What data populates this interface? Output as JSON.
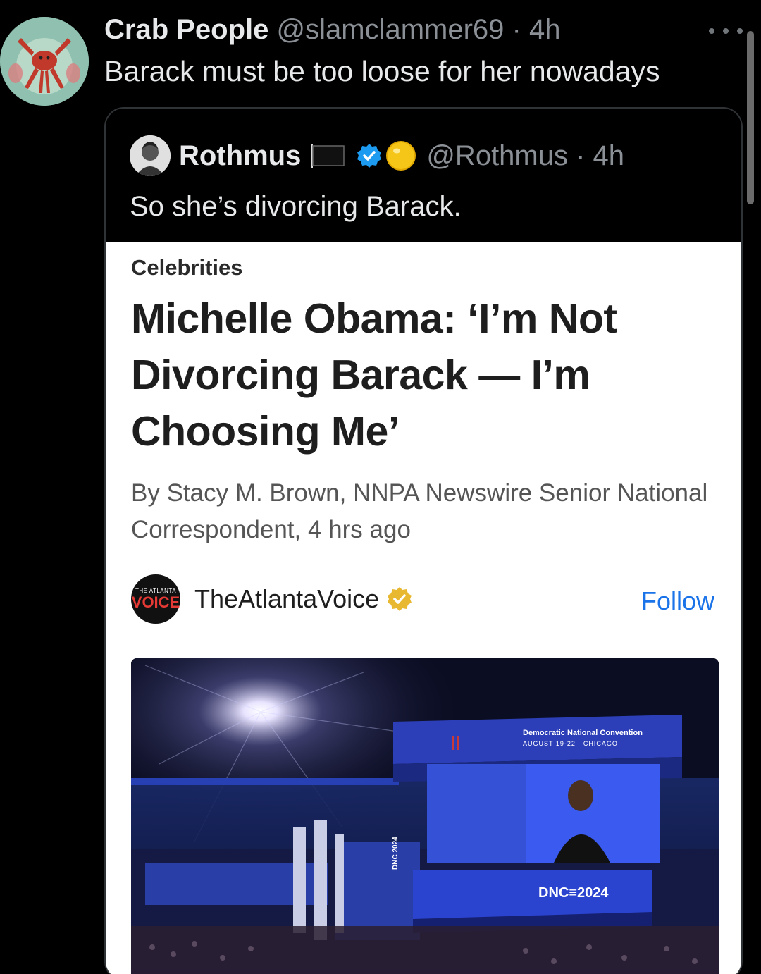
{
  "post": {
    "author_name": "Crab People",
    "author_handle": "@slamclammer69 · 4h",
    "text": "Barack must be too loose for her nowadays"
  },
  "quoted": {
    "author_name": "Rothmus",
    "author_handle": "@Rothmus · 4h",
    "text": "So she’s divorcing Barack."
  },
  "article": {
    "category": "Celebrities",
    "headline": "Michelle Obama: ‘I’m Not Divorcing Barack — I’m Choosing Me’",
    "byline": "By Stacy M. Brown, NNPA Newswire Senior National Correspondent, 4 hrs ago",
    "publisher": {
      "logo_small": "THE ATLANTA",
      "logo_big": "VOICE",
      "name": "TheAtlantaVoice",
      "follow_label": "Follow"
    },
    "image": {
      "banner_line1": "Democratic National Convention",
      "banner_line2": "AUGUST 19-22 · CHICAGO",
      "screen_label": "DNC≡2024",
      "side_label": "DNC 2024"
    }
  },
  "colors": {
    "background": "#000000",
    "card_border": "#2f3336",
    "secondary_text": "#8b9096",
    "follow_blue": "#1a73e8",
    "verified_blue": "#1d9bf0",
    "verified_gold": "#e8b830"
  },
  "icons": {
    "more": "more-horizontal-icon",
    "flag": "black-flag-icon",
    "verified": "verified-badge-icon",
    "emoji": "yellow-circle-emoji",
    "publisher_badge": "gold-verified-badge-icon"
  }
}
